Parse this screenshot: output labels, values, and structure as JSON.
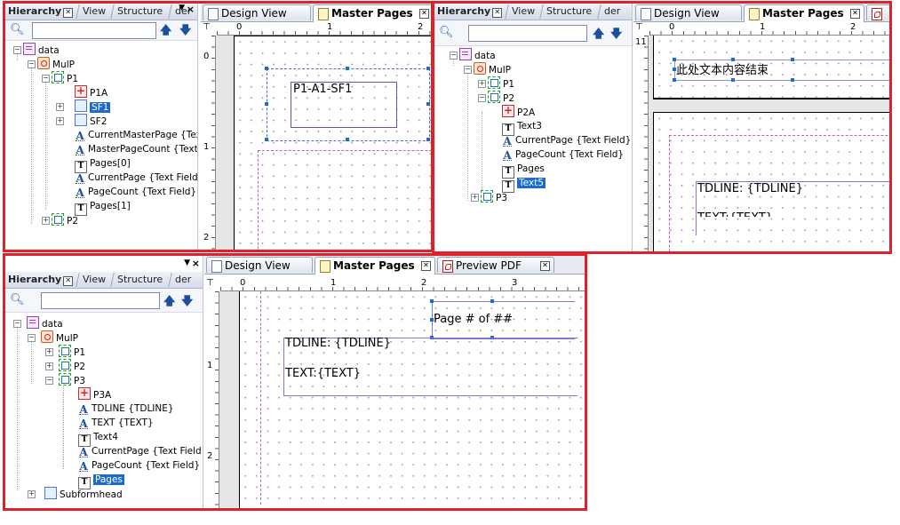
{
  "tabs": {
    "hierarchy": "Hierarchy",
    "view": "View",
    "structure": "Structure",
    "partial": "der",
    "design_view": "Design View",
    "master_pages": "Master Pages",
    "preview_pdf": "Preview PDF"
  },
  "panel1": {
    "tree": [
      "data",
      "MulP",
      "P1",
      "P1A",
      "SF1",
      "SF2",
      "CurrentMasterPage {Tex",
      "MasterPageCount {Text",
      "Pages[0]",
      "CurrentPage {Text Field",
      "PageCount {Text Field}",
      "Pages[1]",
      "P2"
    ],
    "ruler_h": [
      "0",
      "1",
      "2"
    ],
    "ruler_v": [
      "0",
      "1",
      "2"
    ],
    "subform_text": "P1-A1-SF1"
  },
  "panel2": {
    "tree": [
      "data",
      "MulP",
      "P1",
      "P2",
      "P2A",
      "Text3",
      "CurrentPage {Text Field}",
      "PageCount {Text Field}",
      "Pages",
      "Text5",
      "P3"
    ],
    "ruler_h": [
      "0",
      "1",
      "2"
    ],
    "ruler_v": [
      "11"
    ],
    "end_text": "此处文本内容结束",
    "tdline": "TDLINE: {TDLINE}",
    "text_partial": "TEXT:{TEXT}"
  },
  "panel3": {
    "tree": [
      "data",
      "MulP",
      "P1",
      "P2",
      "P3",
      "P3A",
      "TDLINE {TDLINE}",
      "TEXT {TEXT}",
      "Text4",
      "CurrentPage {Text Field",
      "PageCount {Text Field}",
      "Pages",
      "Subformhead"
    ],
    "ruler_h": [
      "0",
      "1",
      "2",
      "3"
    ],
    "ruler_v": [
      "1",
      "2"
    ],
    "page_text": "Page # of ##",
    "tdline": "TDLINE: {TDLINE}",
    "text": "TEXT:{TEXT}"
  }
}
